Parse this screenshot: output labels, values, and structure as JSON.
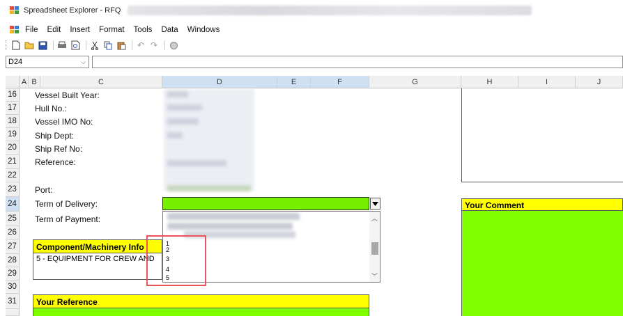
{
  "window": {
    "title": "Spreadsheet Explorer - RFQ"
  },
  "menu": [
    "File",
    "Edit",
    "Insert",
    "Format",
    "Tools",
    "Data",
    "Windows"
  ],
  "toolbar": [
    "new-icon",
    "open-icon",
    "save-icon",
    "print-icon",
    "print-preview-icon",
    "cut-icon",
    "copy-icon",
    "paste-icon",
    "undo-icon",
    "redo-icon",
    "spell-icon"
  ],
  "namebox": {
    "value": "D24"
  },
  "columns": [
    "A",
    "B",
    "C",
    "D",
    "E",
    "F",
    "G",
    "H",
    "I",
    "J"
  ],
  "rows": [
    "16",
    "17",
    "18",
    "19",
    "20",
    "21",
    "22",
    "23",
    "24",
    "25",
    "26",
    "27",
    "28",
    "29",
    "30",
    "31"
  ],
  "labels": {
    "built_year": "Vessel Built Year:",
    "hull": "Hull No.:",
    "imo": "Vessel IMO No:",
    "dept": "Ship Dept:",
    "ref_no": "Ship Ref No:",
    "reference": "Reference:",
    "port": "Port:",
    "delivery": "Term of Delivery:",
    "payment": "Term of Payment:",
    "component": "Component/Machinery Info",
    "equipment": "5 - EQUIPMENT FOR CREW AND",
    "your_reference": "Your Reference",
    "your_comment": "Your Comment"
  },
  "dropdown_items": [
    "1",
    "2",
    "3",
    "4",
    "5"
  ],
  "colors": {
    "yellow": "#ffff00",
    "green": "#80ff00",
    "selected_header": "#cfe0f3",
    "highlight": "#e8545a"
  }
}
